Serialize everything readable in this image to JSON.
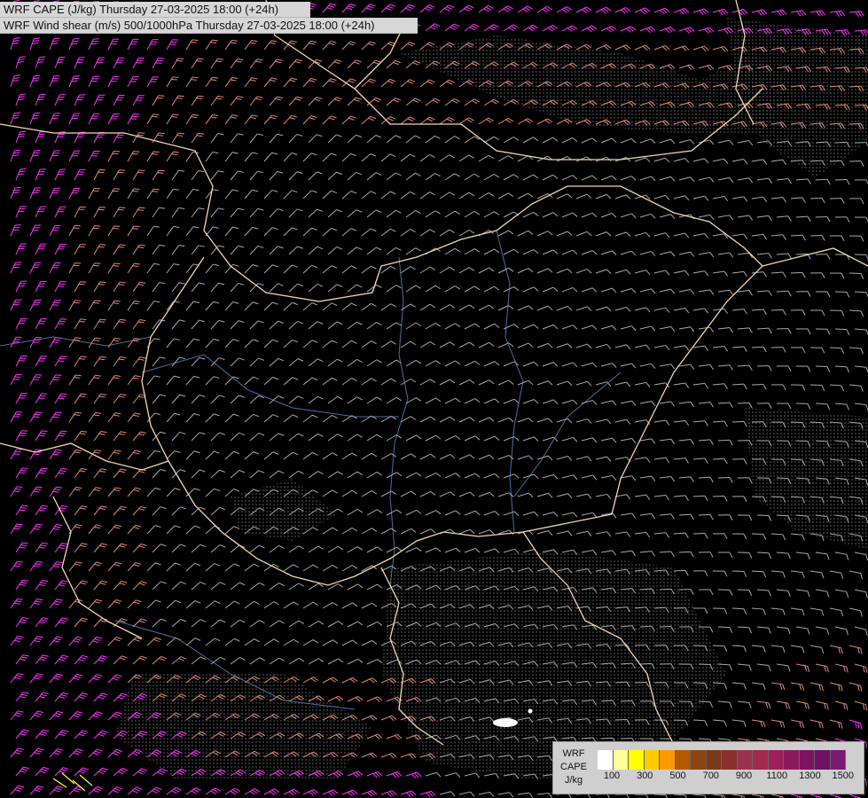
{
  "header": {
    "line1": "WRF CAPE (J/kg) Thursday 27-03-2025 18:00 (+24h)",
    "line2": "WRF Wind shear (m/s) 500/1000hPa Thursday 27-03-2025 18:00 (+24h)"
  },
  "legend": {
    "label_lines": [
      "WRF",
      "CAPE",
      "J/kg"
    ],
    "swatch_colors": [
      "#ffffff",
      "#ffff99",
      "#ffff00",
      "#ffcc00",
      "#ff9900",
      "#b35900",
      "#8b4513",
      "#7a3a1a",
      "#8b2f2f",
      "#99334d",
      "#a3294d",
      "#9e1f5a",
      "#8c1a5e",
      "#7d1460",
      "#701066",
      "#7a1a75"
    ],
    "ticks": [
      "100",
      "300",
      "500",
      "700",
      "900",
      "1100",
      "1300",
      "1500"
    ]
  },
  "colors": {
    "background": "#000000",
    "barb_weak": "#a8a8a8",
    "barb_moderate": "#e08a7a",
    "barb_strong": "#ff33ff",
    "border_line": "#f5d7b0",
    "river_line": "#4a6fa5",
    "cape_low": "#ffff33"
  }
}
